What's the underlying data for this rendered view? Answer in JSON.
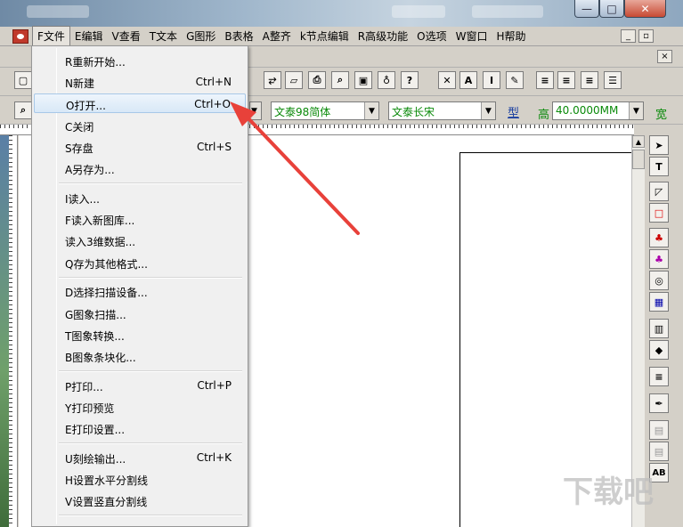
{
  "window": {
    "min": "—",
    "max": "□",
    "close": "✕"
  },
  "menubar": {
    "items": [
      "F文件",
      "E编辑",
      "V查看",
      "T文本",
      "G图形",
      "B表格",
      "A整齐",
      "k节点编辑",
      "R高级功能",
      "O选项",
      "W窗口",
      "H帮助"
    ],
    "active_index": 0,
    "mdi_min": "_",
    "mdi_restore": "▫",
    "mdi_close": "×"
  },
  "toolbar": {
    "font_cn": "文泰98简体",
    "font_en": "文泰长宋",
    "type_label": "型",
    "height_label": "高",
    "height_value": "40.0000MM",
    "width_label": "宽"
  },
  "file_menu": {
    "items": [
      {
        "label": "R重新开始...",
        "shortcut": ""
      },
      {
        "label": "N新建",
        "shortcut": "Ctrl+N"
      },
      {
        "label": "O打开...",
        "shortcut": "Ctrl+O",
        "highlighted": true
      },
      {
        "label": "C关闭",
        "shortcut": ""
      },
      {
        "label": "S存盘",
        "shortcut": "Ctrl+S"
      },
      {
        "label": "A另存为...",
        "shortcut": ""
      },
      {
        "label": "I读入...",
        "shortcut": ""
      },
      {
        "label": "F读入新图库...",
        "shortcut": ""
      },
      {
        "label": "读入3维数据...",
        "shortcut": ""
      },
      {
        "label": "Q存为其他格式...",
        "shortcut": ""
      },
      {
        "label": "D选择扫描设备...",
        "shortcut": ""
      },
      {
        "label": "G图象扫描...",
        "shortcut": ""
      },
      {
        "label": "T图象转换...",
        "shortcut": ""
      },
      {
        "label": "B图象条块化...",
        "shortcut": ""
      },
      {
        "label": "P打印...",
        "shortcut": "Ctrl+P"
      },
      {
        "label": "Y打印预览",
        "shortcut": ""
      },
      {
        "label": "E打印设置...",
        "shortcut": ""
      },
      {
        "label": "U刻绘输出...",
        "shortcut": "Ctrl+K"
      },
      {
        "label": "H设置水平分割线",
        "shortcut": ""
      },
      {
        "label": "V设置竖直分割线",
        "shortcut": ""
      }
    ]
  },
  "watermark": "下载吧",
  "colors": {
    "arrow": "#e8413a",
    "highlight": "#d8e8f7",
    "combo_text": "#0a8a0a"
  }
}
